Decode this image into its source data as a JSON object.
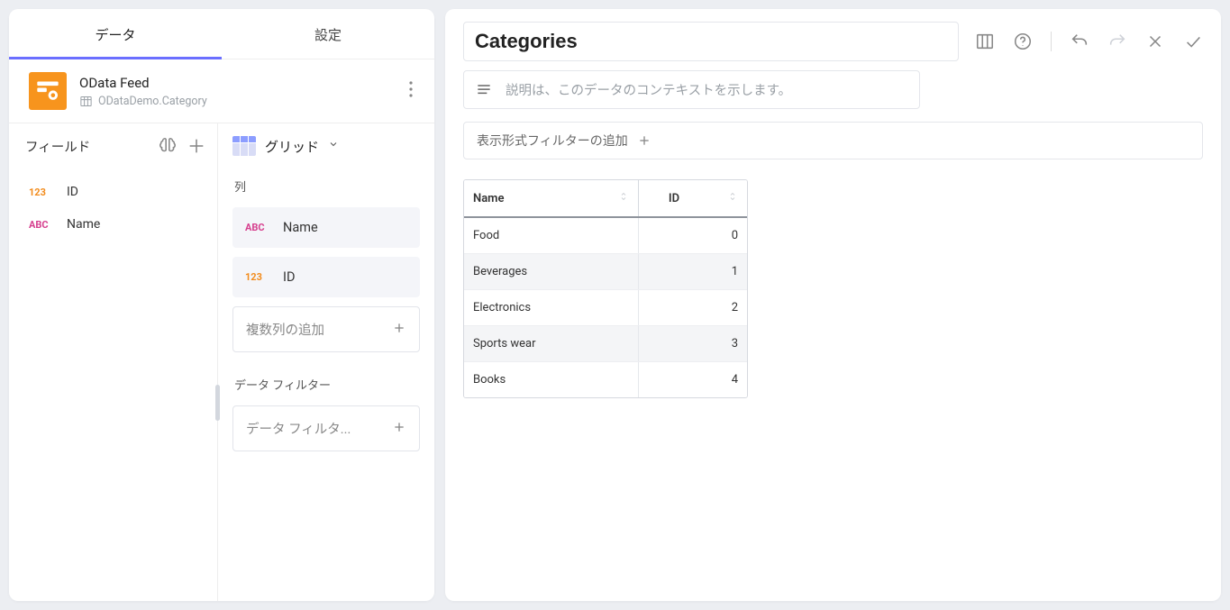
{
  "tabs": {
    "data": "データ",
    "settings": "設定"
  },
  "datasource": {
    "title": "OData Feed",
    "subtitle": "ODataDemo.Category"
  },
  "fields": {
    "header": "フィールド",
    "items": [
      {
        "type": "123",
        "label": "ID"
      },
      {
        "type": "ABC",
        "label": "Name"
      }
    ]
  },
  "config": {
    "viz_label": "グリッド",
    "columns_label": "列",
    "columns": [
      {
        "type": "ABC",
        "label": "Name"
      },
      {
        "type": "123",
        "label": "ID"
      }
    ],
    "add_columns_placeholder": "複数列の追加",
    "filters_label": "データ フィルター",
    "add_filter_placeholder": "データ フィルタ..."
  },
  "main": {
    "title": "Categories",
    "description_placeholder": "説明は、このデータのコンテキストを示します。",
    "add_viz_filter": "表示形式フィルターの追加",
    "table": {
      "headers": {
        "name": "Name",
        "id": "ID"
      },
      "rows": [
        {
          "name": "Food",
          "id": "0"
        },
        {
          "name": "Beverages",
          "id": "1"
        },
        {
          "name": "Electronics",
          "id": "2"
        },
        {
          "name": "Sports wear",
          "id": "3"
        },
        {
          "name": "Books",
          "id": "4"
        }
      ]
    }
  }
}
